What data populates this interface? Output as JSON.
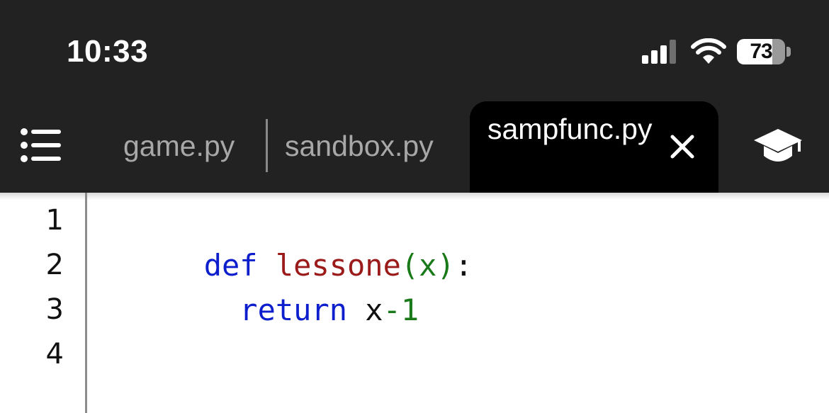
{
  "status_bar": {
    "time": "10:33",
    "battery_level": "73",
    "battery_fraction": 0.73
  },
  "tabs": [
    {
      "label": "game.py",
      "active": false
    },
    {
      "label": "sandbox.py",
      "active": false
    },
    {
      "label": "sampfunc.py",
      "active": true
    }
  ],
  "editor": {
    "line_numbers": [
      "1",
      "2",
      "3",
      "4"
    ],
    "code": [
      [
        {
          "text": "def",
          "kind": "keyword"
        },
        {
          "text": " ",
          "kind": "plain"
        },
        {
          "text": "lessone",
          "kind": "function"
        },
        {
          "text": "(x)",
          "kind": "operator"
        },
        {
          "text": ":",
          "kind": "plain"
        }
      ],
      [
        {
          "text": "  ",
          "kind": "plain"
        },
        {
          "text": "return",
          "kind": "keyword"
        },
        {
          "text": " x",
          "kind": "plain"
        },
        {
          "text": "-",
          "kind": "operator"
        },
        {
          "text": "1",
          "kind": "number"
        }
      ],
      [],
      []
    ]
  },
  "colors": {
    "chrome_background": "#222222",
    "active_tab_background": "#000000",
    "keyword": "#0d1fcc",
    "function_name": "#9b1b1b",
    "number": "#1a7a1a"
  },
  "icons": {
    "menu": "list-icon",
    "close": "close-icon",
    "learn": "graduation-cap-icon",
    "signal": "cellular-signal-icon",
    "wifi": "wifi-icon",
    "battery": "battery-icon"
  }
}
